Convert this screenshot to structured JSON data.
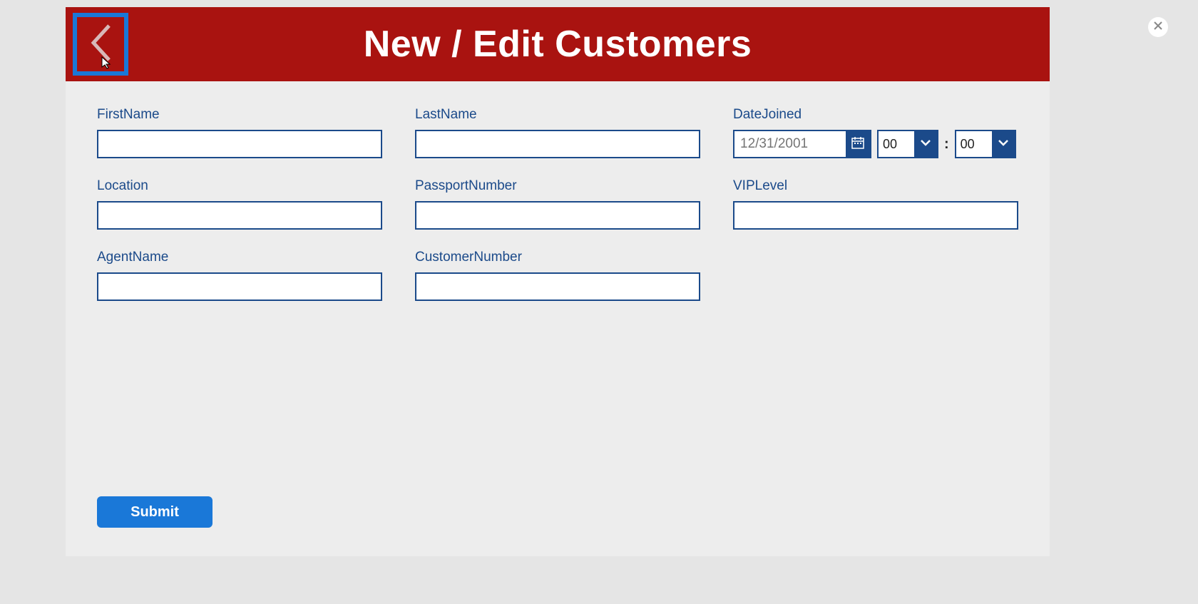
{
  "header": {
    "title": "New / Edit Customers"
  },
  "form": {
    "firstName": {
      "label": "FirstName",
      "value": ""
    },
    "lastName": {
      "label": "LastName",
      "value": ""
    },
    "dateJoined": {
      "label": "DateJoined",
      "date_placeholder": "12/31/2001",
      "hour": "00",
      "minute": "00",
      "separator": ":"
    },
    "location": {
      "label": "Location",
      "value": ""
    },
    "passportNumber": {
      "label": "PassportNumber",
      "value": ""
    },
    "vipLevel": {
      "label": "VIPLevel",
      "value": ""
    },
    "agentName": {
      "label": "AgentName",
      "value": ""
    },
    "customerNumber": {
      "label": "CustomerNumber",
      "value": ""
    }
  },
  "buttons": {
    "submit": "Submit"
  }
}
